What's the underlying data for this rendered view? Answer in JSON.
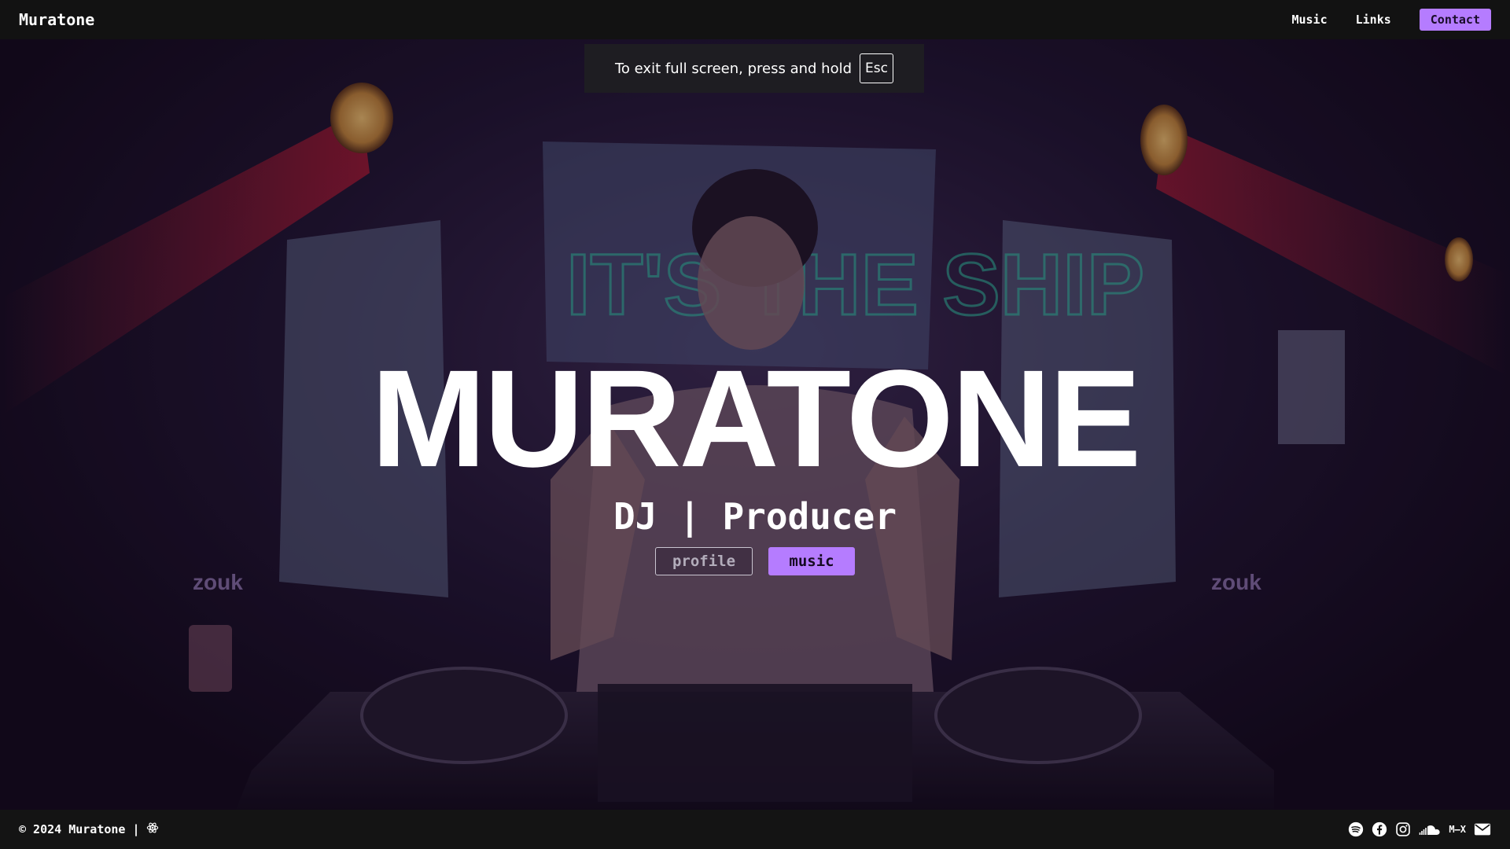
{
  "header": {
    "brand": "Muratone",
    "nav": {
      "music": "Music",
      "links": "Links",
      "contact": "Contact"
    }
  },
  "fullscreen_notice": {
    "message": "To exit full screen, press and hold",
    "key": "Esc"
  },
  "hero": {
    "title": "MURATONE",
    "subtitle": "DJ | Producer",
    "buttons": {
      "profile": "profile",
      "music": "music"
    }
  },
  "footer": {
    "copyright": "© 2024 Muratone |",
    "icons": [
      "react-icon",
      "spotify-icon",
      "facebook-icon",
      "instagram-icon",
      "soundcloud-icon",
      "mixcloud-icon",
      "mail-icon"
    ],
    "mixcloud_label": "M–X"
  },
  "colors": {
    "accent": "#b57cff",
    "header_bg": "#121212",
    "footer_bg": "#141414"
  }
}
